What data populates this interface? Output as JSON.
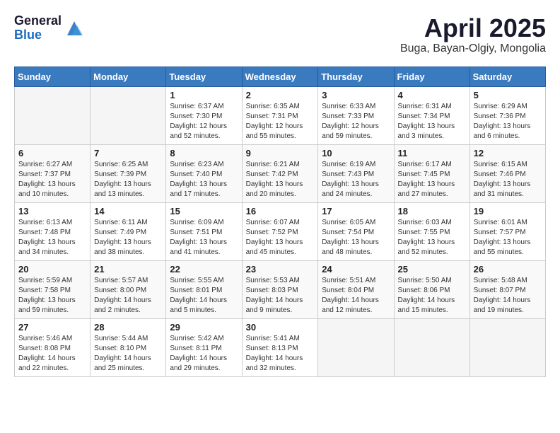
{
  "header": {
    "logo_general": "General",
    "logo_blue": "Blue",
    "month_year": "April 2025",
    "location": "Buga, Bayan-Olgiy, Mongolia"
  },
  "weekdays": [
    "Sunday",
    "Monday",
    "Tuesday",
    "Wednesday",
    "Thursday",
    "Friday",
    "Saturday"
  ],
  "weeks": [
    [
      {
        "day": "",
        "info": ""
      },
      {
        "day": "",
        "info": ""
      },
      {
        "day": "1",
        "info": "Sunrise: 6:37 AM\nSunset: 7:30 PM\nDaylight: 12 hours\nand 52 minutes."
      },
      {
        "day": "2",
        "info": "Sunrise: 6:35 AM\nSunset: 7:31 PM\nDaylight: 12 hours\nand 55 minutes."
      },
      {
        "day": "3",
        "info": "Sunrise: 6:33 AM\nSunset: 7:33 PM\nDaylight: 12 hours\nand 59 minutes."
      },
      {
        "day": "4",
        "info": "Sunrise: 6:31 AM\nSunset: 7:34 PM\nDaylight: 13 hours\nand 3 minutes."
      },
      {
        "day": "5",
        "info": "Sunrise: 6:29 AM\nSunset: 7:36 PM\nDaylight: 13 hours\nand 6 minutes."
      }
    ],
    [
      {
        "day": "6",
        "info": "Sunrise: 6:27 AM\nSunset: 7:37 PM\nDaylight: 13 hours\nand 10 minutes."
      },
      {
        "day": "7",
        "info": "Sunrise: 6:25 AM\nSunset: 7:39 PM\nDaylight: 13 hours\nand 13 minutes."
      },
      {
        "day": "8",
        "info": "Sunrise: 6:23 AM\nSunset: 7:40 PM\nDaylight: 13 hours\nand 17 minutes."
      },
      {
        "day": "9",
        "info": "Sunrise: 6:21 AM\nSunset: 7:42 PM\nDaylight: 13 hours\nand 20 minutes."
      },
      {
        "day": "10",
        "info": "Sunrise: 6:19 AM\nSunset: 7:43 PM\nDaylight: 13 hours\nand 24 minutes."
      },
      {
        "day": "11",
        "info": "Sunrise: 6:17 AM\nSunset: 7:45 PM\nDaylight: 13 hours\nand 27 minutes."
      },
      {
        "day": "12",
        "info": "Sunrise: 6:15 AM\nSunset: 7:46 PM\nDaylight: 13 hours\nand 31 minutes."
      }
    ],
    [
      {
        "day": "13",
        "info": "Sunrise: 6:13 AM\nSunset: 7:48 PM\nDaylight: 13 hours\nand 34 minutes."
      },
      {
        "day": "14",
        "info": "Sunrise: 6:11 AM\nSunset: 7:49 PM\nDaylight: 13 hours\nand 38 minutes."
      },
      {
        "day": "15",
        "info": "Sunrise: 6:09 AM\nSunset: 7:51 PM\nDaylight: 13 hours\nand 41 minutes."
      },
      {
        "day": "16",
        "info": "Sunrise: 6:07 AM\nSunset: 7:52 PM\nDaylight: 13 hours\nand 45 minutes."
      },
      {
        "day": "17",
        "info": "Sunrise: 6:05 AM\nSunset: 7:54 PM\nDaylight: 13 hours\nand 48 minutes."
      },
      {
        "day": "18",
        "info": "Sunrise: 6:03 AM\nSunset: 7:55 PM\nDaylight: 13 hours\nand 52 minutes."
      },
      {
        "day": "19",
        "info": "Sunrise: 6:01 AM\nSunset: 7:57 PM\nDaylight: 13 hours\nand 55 minutes."
      }
    ],
    [
      {
        "day": "20",
        "info": "Sunrise: 5:59 AM\nSunset: 7:58 PM\nDaylight: 13 hours\nand 59 minutes."
      },
      {
        "day": "21",
        "info": "Sunrise: 5:57 AM\nSunset: 8:00 PM\nDaylight: 14 hours\nand 2 minutes."
      },
      {
        "day": "22",
        "info": "Sunrise: 5:55 AM\nSunset: 8:01 PM\nDaylight: 14 hours\nand 5 minutes."
      },
      {
        "day": "23",
        "info": "Sunrise: 5:53 AM\nSunset: 8:03 PM\nDaylight: 14 hours\nand 9 minutes."
      },
      {
        "day": "24",
        "info": "Sunrise: 5:51 AM\nSunset: 8:04 PM\nDaylight: 14 hours\nand 12 minutes."
      },
      {
        "day": "25",
        "info": "Sunrise: 5:50 AM\nSunset: 8:06 PM\nDaylight: 14 hours\nand 15 minutes."
      },
      {
        "day": "26",
        "info": "Sunrise: 5:48 AM\nSunset: 8:07 PM\nDaylight: 14 hours\nand 19 minutes."
      }
    ],
    [
      {
        "day": "27",
        "info": "Sunrise: 5:46 AM\nSunset: 8:08 PM\nDaylight: 14 hours\nand 22 minutes."
      },
      {
        "day": "28",
        "info": "Sunrise: 5:44 AM\nSunset: 8:10 PM\nDaylight: 14 hours\nand 25 minutes."
      },
      {
        "day": "29",
        "info": "Sunrise: 5:42 AM\nSunset: 8:11 PM\nDaylight: 14 hours\nand 29 minutes."
      },
      {
        "day": "30",
        "info": "Sunrise: 5:41 AM\nSunset: 8:13 PM\nDaylight: 14 hours\nand 32 minutes."
      },
      {
        "day": "",
        "info": ""
      },
      {
        "day": "",
        "info": ""
      },
      {
        "day": "",
        "info": ""
      }
    ]
  ]
}
